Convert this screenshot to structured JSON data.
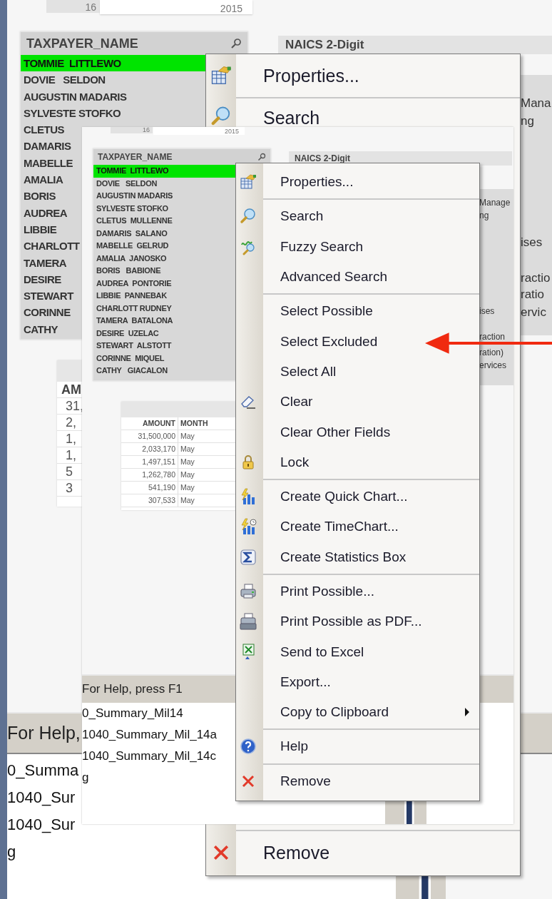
{
  "back": {
    "top_fields": [
      "16",
      "2015"
    ],
    "listbox": {
      "title": "TAXPAYER_NAME",
      "items": [
        {
          "text": "TOMMIE  LITTLEWO",
          "selected": true
        },
        {
          "text": "DOVIE   SELDON",
          "selected": false
        },
        {
          "text": "AUGUSTIN MADARIS",
          "selected": false
        },
        {
          "text": "SYLVESTE STOFKO",
          "selected": false
        },
        {
          "text": "CLETUS",
          "selected": false
        },
        {
          "text": "DAMARIS",
          "selected": false
        },
        {
          "text": "MABELLE",
          "selected": false
        },
        {
          "text": "AMALIA",
          "selected": false
        },
        {
          "text": "BORIS",
          "selected": false
        },
        {
          "text": "AUDREA",
          "selected": false
        },
        {
          "text": "LIBBIE",
          "selected": false
        },
        {
          "text": "CHARLOTT",
          "selected": false
        },
        {
          "text": "TAMERA",
          "selected": false
        },
        {
          "text": "DESIRE",
          "selected": false
        },
        {
          "text": "STEWART",
          "selected": false
        },
        {
          "text": "CORINNE",
          "selected": false
        },
        {
          "text": "CATHY",
          "selected": false
        }
      ]
    },
    "naics": {
      "title": "NAICS 2-Digit",
      "labels": [
        "Mana",
        "ng",
        "ises",
        "ractio",
        "ratio",
        "ervic"
      ]
    },
    "table": {
      "column": "AM",
      "cells": [
        "31,",
        "2,",
        "1,",
        "1,",
        "5",
        "3"
      ]
    },
    "menu": {
      "groups": [
        [
          {
            "label": "Properties...",
            "kind": "properties",
            "submenu": false
          }
        ],
        [
          {
            "label": "Search",
            "kind": "search",
            "submenu": false
          }
        ],
        [
          {
            "label": "Remove",
            "kind": "remove",
            "submenu": false
          }
        ]
      ]
    },
    "status_bar": "For Help,",
    "files": [
      "0_Summa",
      "1040_Sur",
      "1040_Sur",
      "g"
    ]
  },
  "front": {
    "top_fields": [
      "16",
      "2015"
    ],
    "listbox": {
      "title": "TAXPAYER_NAME",
      "items": [
        {
          "text": "TOMMIE  LITTLEWO",
          "selected": true
        },
        {
          "text": "DOVIE   SELDON",
          "selected": false
        },
        {
          "text": "AUGUSTIN MADARIS",
          "selected": false
        },
        {
          "text": "SYLVESTE STOFKO",
          "selected": false
        },
        {
          "text": "CLETUS  MULLENNE",
          "selected": false
        },
        {
          "text": "DAMARIS  SALANO",
          "selected": false
        },
        {
          "text": "MABELLE  GELRUD",
          "selected": false
        },
        {
          "text": "AMALIA  JANOSKO",
          "selected": false
        },
        {
          "text": "BORIS   BABIONE",
          "selected": false
        },
        {
          "text": "AUDREA  PONTORIE",
          "selected": false
        },
        {
          "text": "LIBBIE  PANNEBAK",
          "selected": false
        },
        {
          "text": "CHARLOTT RUDNEY",
          "selected": false
        },
        {
          "text": "TAMERA  BATALONA",
          "selected": false
        },
        {
          "text": "DESIRE  UZELAC",
          "selected": false
        },
        {
          "text": "STEWART  ALSTOTT",
          "selected": false
        },
        {
          "text": "CORINNE  MIQUEL",
          "selected": false
        },
        {
          "text": "CATHY   GIACALON",
          "selected": false
        }
      ]
    },
    "naics": {
      "title": "NAICS 2-Digit",
      "labels": [
        "Manage",
        "ng",
        "ises",
        "raction",
        "ration)",
        "ervices"
      ]
    },
    "table": {
      "columns": [
        "AMOUNT",
        "MONTH"
      ],
      "rows": [
        [
          "31,500,000",
          "May"
        ],
        [
          "2,033,170",
          "May"
        ],
        [
          "1,497,151",
          "May"
        ],
        [
          "1,262,780",
          "May"
        ],
        [
          "541,190",
          "May"
        ],
        [
          "307,533",
          "May"
        ]
      ]
    },
    "menu": {
      "groups": [
        [
          {
            "label": "Properties...",
            "kind": "properties",
            "submenu": false
          }
        ],
        [
          {
            "label": "Search",
            "kind": "search",
            "submenu": false
          },
          {
            "label": "Fuzzy Search",
            "kind": "fuzzy",
            "submenu": false
          },
          {
            "label": "Advanced Search",
            "kind": "plain",
            "submenu": false
          }
        ],
        [
          {
            "label": "Select Possible",
            "kind": "plain",
            "submenu": false
          },
          {
            "label": "Select Excluded",
            "kind": "plain",
            "submenu": false
          },
          {
            "label": "Select All",
            "kind": "plain",
            "submenu": false
          },
          {
            "label": "Clear",
            "kind": "eraser",
            "submenu": false
          },
          {
            "label": "Clear Other Fields",
            "kind": "plain",
            "submenu": false
          },
          {
            "label": "Lock",
            "kind": "lock",
            "submenu": false
          }
        ],
        [
          {
            "label": "Create Quick Chart...",
            "kind": "quick-chart",
            "submenu": false
          },
          {
            "label": "Create TimeChart...",
            "kind": "time-chart",
            "submenu": false
          },
          {
            "label": "Create Statistics Box",
            "kind": "sigma",
            "submenu": false
          }
        ],
        [
          {
            "label": "Print Possible...",
            "kind": "printer",
            "submenu": false
          },
          {
            "label": "Print Possible as PDF...",
            "kind": "pdf-printer",
            "submenu": false
          },
          {
            "label": "Send to Excel",
            "kind": "excel",
            "submenu": false
          },
          {
            "label": "Export...",
            "kind": "plain",
            "submenu": false
          },
          {
            "label": "Copy to Clipboard",
            "kind": "plain",
            "submenu": true
          }
        ],
        [
          {
            "label": "Help",
            "kind": "help",
            "submenu": false
          }
        ],
        [
          {
            "label": "Remove",
            "kind": "remove",
            "submenu": false
          }
        ]
      ]
    },
    "status_bar": "For Help, press F1",
    "files": [
      "0_Summary_Mil14",
      "1040_Summary_Mil_14a",
      "1040_Summary_Mil_14c",
      "g"
    ]
  }
}
